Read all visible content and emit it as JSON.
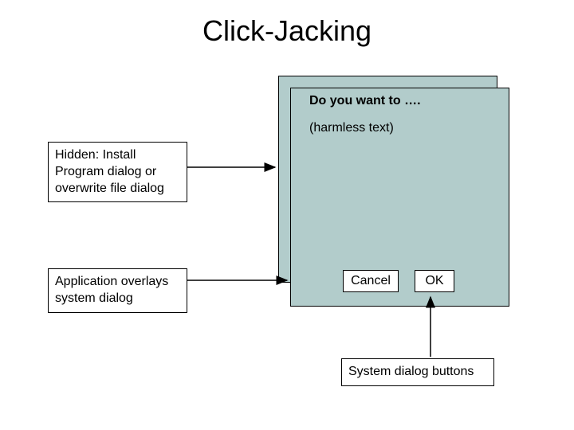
{
  "title": "Click-Jacking",
  "labels": {
    "hidden": "Hidden: Install Program dialog or overwrite file dialog",
    "overlay": "Application overlays system dialog",
    "sysbuttons": "System dialog buttons"
  },
  "dialog": {
    "title": "Do you want to ….",
    "subtitle": "(harmless text)",
    "buttons": {
      "cancel": "Cancel",
      "ok": "OK"
    }
  }
}
